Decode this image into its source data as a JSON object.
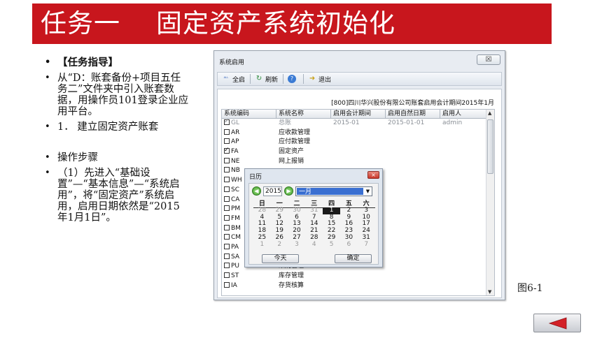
{
  "slide": {
    "title": "任务一    固定资产系统初始化",
    "bullets": [
      {
        "text": "【任务指导】",
        "bold": true
      },
      {
        "text": "从“D：账套备份+项目五任务二”文件夹中引入账套数据，用操作员101登录企业应用平台。",
        "bold": false
      },
      {
        "text": "1． 建立固定资产账套",
        "bold": false
      }
    ],
    "bullets2": [
      {
        "text": "操作步骤"
      },
      {
        "text": "（1）先进入“基础设置”—“基本信息”—“系统启用”，将“固定资产”系统启用，启用日期依然是“2015年1月1日”。"
      }
    ],
    "caption": "图6-1"
  },
  "window": {
    "title": "系统启用",
    "close_glyph": "☒",
    "toolbar": [
      {
        "icon": "select-all-icon",
        "glyph": "ᴬᴸᴸ",
        "label": "全启"
      },
      {
        "icon": "refresh-icon",
        "glyph": "↻",
        "label": "刷新"
      },
      {
        "icon": "help-icon",
        "glyph": "?",
        "label": ""
      },
      {
        "icon": "exit-icon",
        "glyph": "➜",
        "label": "退出"
      }
    ],
    "company_line": "[800]四川华兴股份有限公司账套启用会计期间2015年1月",
    "columns": [
      "系统编码",
      "系统名称",
      "启用会计期间",
      "启用自然日期",
      "启用人"
    ],
    "rows": [
      {
        "checked": true,
        "code": "GL",
        "name": "总账",
        "period": "2015-01",
        "date": "2015-01-01",
        "user": "admin",
        "grey": true
      },
      {
        "checked": false,
        "code": "AR",
        "name": "应收款管理",
        "period": "",
        "date": "",
        "user": "",
        "grey": false
      },
      {
        "checked": false,
        "code": "AP",
        "name": "应付款管理",
        "period": "",
        "date": "",
        "user": "",
        "grey": false
      },
      {
        "checked": true,
        "code": "FA",
        "name": "固定资产",
        "period": "",
        "date": "",
        "user": "",
        "grey": false
      },
      {
        "checked": false,
        "code": "NE",
        "name": "网上报销",
        "period": "",
        "date": "",
        "user": "",
        "grey": false
      },
      {
        "checked": false,
        "code": "NB",
        "name": "",
        "period": "",
        "date": "",
        "user": "",
        "grey": false
      },
      {
        "checked": false,
        "code": "WH",
        "name": "",
        "period": "",
        "date": "",
        "user": "",
        "grey": false
      },
      {
        "checked": false,
        "code": "SC",
        "name": "",
        "period": "",
        "date": "",
        "user": "",
        "grey": false
      },
      {
        "checked": false,
        "code": "CA",
        "name": "",
        "period": "",
        "date": "",
        "user": "",
        "grey": false
      },
      {
        "checked": false,
        "code": "PM",
        "name": "",
        "period": "",
        "date": "",
        "user": "",
        "grey": false
      },
      {
        "checked": false,
        "code": "FM",
        "name": "",
        "period": "",
        "date": "",
        "user": "",
        "grey": false
      },
      {
        "checked": false,
        "code": "BM",
        "name": "",
        "period": "",
        "date": "",
        "user": "",
        "grey": false
      },
      {
        "checked": false,
        "code": "CM",
        "name": "",
        "period": "",
        "date": "",
        "user": "",
        "grey": false
      },
      {
        "checked": false,
        "code": "PA",
        "name": "",
        "period": "",
        "date": "",
        "user": "",
        "grey": false
      },
      {
        "checked": false,
        "code": "SA",
        "name": "",
        "period": "",
        "date": "",
        "user": "",
        "grey": false
      },
      {
        "checked": false,
        "code": "PU",
        "name": "采购管理",
        "period": "",
        "date": "",
        "user": "",
        "grey": false
      },
      {
        "checked": false,
        "code": "ST",
        "name": "库存管理",
        "period": "",
        "date": "",
        "user": "",
        "grey": false
      },
      {
        "checked": false,
        "code": "IA",
        "name": "存货核算",
        "period": "",
        "date": "",
        "user": "",
        "grey": false
      }
    ]
  },
  "calendar": {
    "title": "日历",
    "close_glyph": "×",
    "year": "2015",
    "month": "一月",
    "weekdays": [
      "日",
      "一",
      "二",
      "三",
      "四",
      "五",
      "六"
    ],
    "weeks": [
      [
        "28",
        "29",
        "30",
        "31",
        "1",
        "2",
        "3"
      ],
      [
        "4",
        "5",
        "6",
        "7",
        "8",
        "9",
        "10"
      ],
      [
        "11",
        "12",
        "13",
        "14",
        "15",
        "16",
        "17"
      ],
      [
        "18",
        "19",
        "20",
        "21",
        "22",
        "23",
        "24"
      ],
      [
        "25",
        "26",
        "27",
        "28",
        "29",
        "30",
        "31"
      ],
      [
        "1",
        "2",
        "3",
        "4",
        "5",
        "6",
        "7"
      ]
    ],
    "dim_first_row_count": 4,
    "selected_cell": [
      0,
      4
    ],
    "today_label": "今天",
    "ok_label": "确定"
  },
  "colors": {
    "title_bg": "#c8161d",
    "accent_select": "#3a6fd1"
  }
}
